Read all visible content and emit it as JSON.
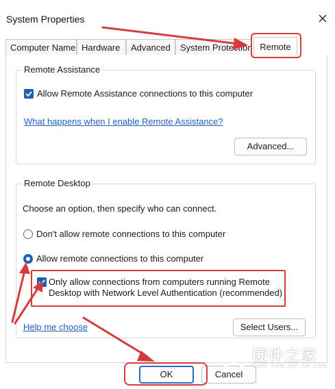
{
  "window": {
    "title": "System Properties",
    "close_icon": "close-icon"
  },
  "tabs": [
    {
      "label": "Computer Name",
      "active": false
    },
    {
      "label": "Hardware",
      "active": false
    },
    {
      "label": "Advanced",
      "active": false
    },
    {
      "label": "System Protection",
      "active": false
    },
    {
      "label": "Remote",
      "active": true
    }
  ],
  "remote_assistance": {
    "group_title": "Remote Assistance",
    "allow_checkbox_label": "Allow Remote Assistance connections to this computer",
    "allow_checked": true,
    "help_link": "What happens when I enable Remote Assistance?",
    "advanced_button": "Advanced..."
  },
  "remote_desktop": {
    "group_title": "Remote Desktop",
    "instruction": "Choose an option, then specify who can connect.",
    "option_dont_allow": "Don't allow remote connections to this computer",
    "option_allow": "Allow remote connections to this computer",
    "selected_option": "allow",
    "nla_label_line1": "Only allow connections from computers running Remote",
    "nla_label_line2": "Desktop with Network Level Authentication (recommended)",
    "nla_checked": true,
    "help_link": "Help me choose",
    "select_users_button": "Select Users..."
  },
  "footer": {
    "ok_button": "OK",
    "cancel_button": "Cancel"
  },
  "watermark": {
    "text": "硬件之家",
    "subtext": "YING JIAN ZHI JIA.COM"
  },
  "colors": {
    "accent": "#1f5fb5",
    "link": "#2060c0",
    "annotation": "#d63a3a"
  }
}
